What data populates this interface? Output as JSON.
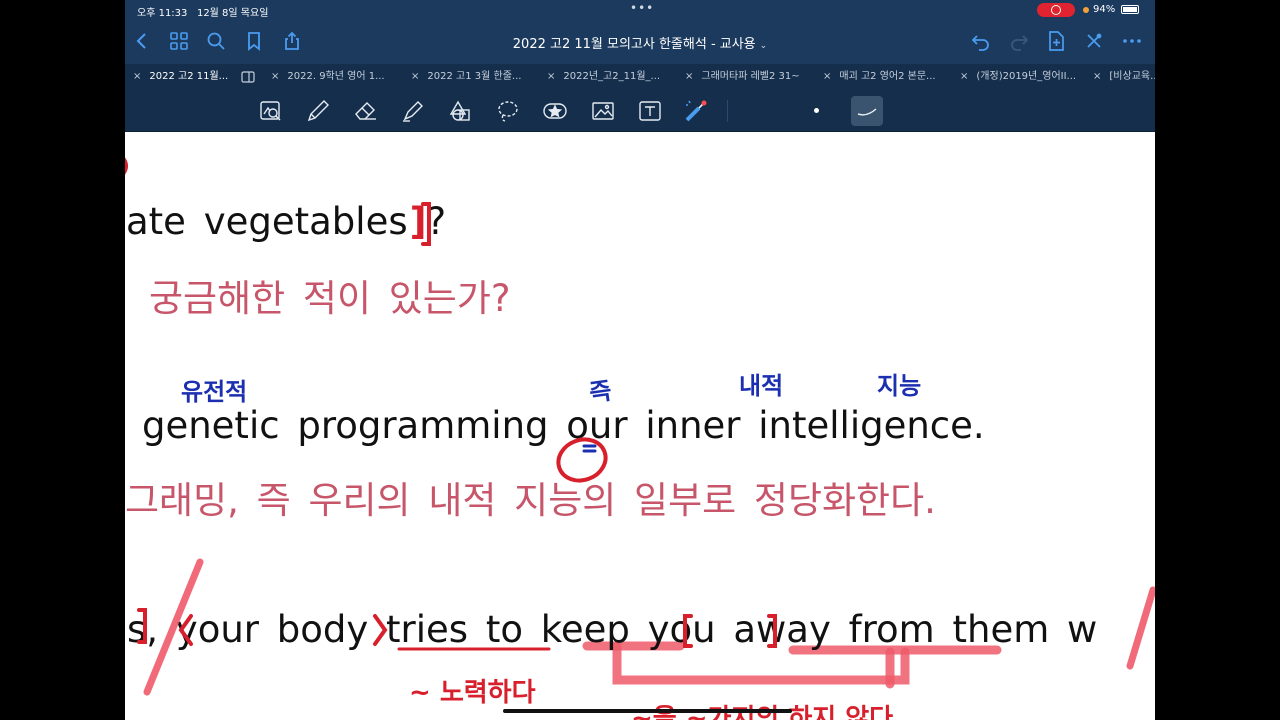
{
  "status": {
    "time": "오후 11:33",
    "date": "12월 8일 목요일",
    "battery": "94%"
  },
  "nav": {
    "title": "2022 고2 11월 모의고사 한줄해석 - 교사용",
    "title_chevron": "⌄"
  },
  "tabs": [
    {
      "label": "2022 고2 11월...",
      "active": true
    },
    {
      "label": "2022. 9학년 영어 1..."
    },
    {
      "label": "2022 고1 3월 한줄..."
    },
    {
      "label": "2022년_고2_11월_..."
    },
    {
      "label": "그래머타파 레벨2 31~"
    },
    {
      "label": "매괴 고2 영어2 본문..."
    },
    {
      "label": "(개정)2019년_영어II..."
    },
    {
      "label": "[비상교육..."
    }
  ],
  "tab_close": "×",
  "document": {
    "line1_en": "ate vegetables",
    "line1_qmark": "?",
    "line1_ko": "궁금해한 적이 있는가?",
    "line2_en": "r genetic programming our inner intelligence.",
    "line2_ko": "그래밍, 즉 우리의 내적 지능의 일부로 정당화한다.",
    "line3_en": "s, your body tries to keep you away from them w",
    "annotations": {
      "yujeonjeok": "유전적",
      "jeuk": "즉",
      "naejeok": "내적",
      "jineung": "지능",
      "noryeokhada": "~ 노력하다",
      "bottom_partial": "~을 ~가지의 하지 않다"
    }
  },
  "colors": {
    "bar_bg": "#1b3a5e",
    "tab_bg": "#142e4c",
    "korean_text": "#c7566a",
    "ink_red": "#d8202c",
    "ink_blue": "#1b2fb0",
    "highlight_red": "#ef5a6a"
  },
  "icons": {
    "nav": [
      "back-icon",
      "grid-icon",
      "search-icon",
      "bookmark-icon",
      "share-icon",
      "undo-icon",
      "redo-icon",
      "add-page-icon",
      "close-x-icon",
      "more-icon"
    ],
    "tools": [
      "zoom-select-icon",
      "pen-icon",
      "eraser-icon",
      "highlighter-icon",
      "shapes-icon",
      "lasso-icon",
      "sticker-icon",
      "image-icon",
      "text-icon",
      "laser-pointer-icon"
    ]
  }
}
